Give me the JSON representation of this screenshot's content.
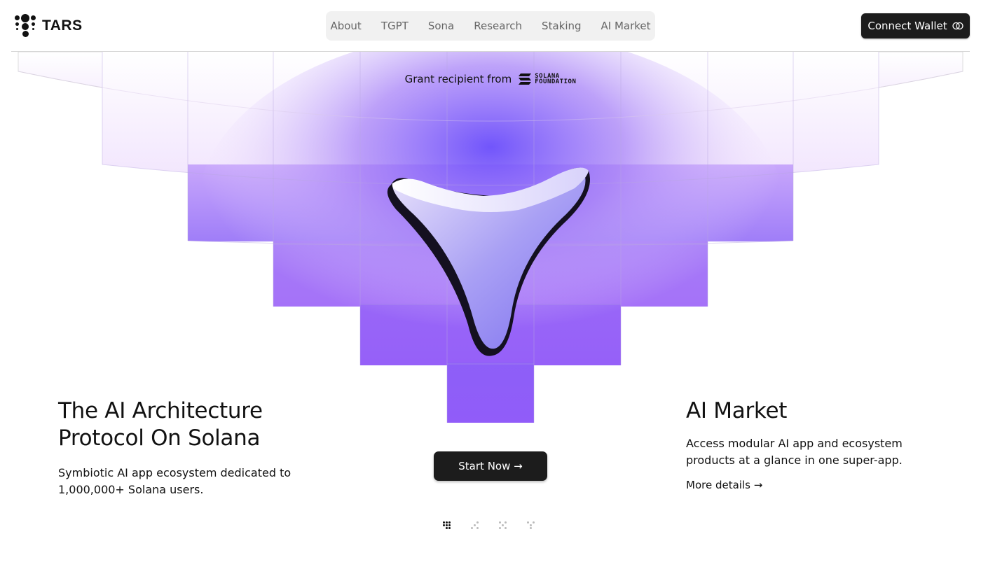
{
  "brand": {
    "name": "TARS"
  },
  "nav": {
    "items": [
      {
        "label": "About"
      },
      {
        "label": "TGPT"
      },
      {
        "label": "Sona"
      },
      {
        "label": "Research"
      },
      {
        "label": "Staking"
      },
      {
        "label": "AI Market"
      }
    ]
  },
  "header": {
    "wallet_label": "Connect Wallet"
  },
  "grant": {
    "text": "Grant recipient from",
    "org_line1": "SOLANA",
    "org_line2": "FOUNDATION"
  },
  "hero": {
    "title_line1": "The AI Architecture",
    "title_line2": "Protocol On Solana",
    "subtitle": "Symbiotic AI app ecosystem dedicated to 1,000,000+ Solana users.",
    "cta_label": "Start Now →"
  },
  "market": {
    "title": "AI Market",
    "description": "Access modular AI app and ecosystem products at a glance in one super-app.",
    "link_label": "More details →"
  },
  "slides": {
    "count": 4,
    "active_index": 0
  },
  "colors": {
    "accent": "#8b5cf6",
    "dark": "#1c1c1c"
  }
}
